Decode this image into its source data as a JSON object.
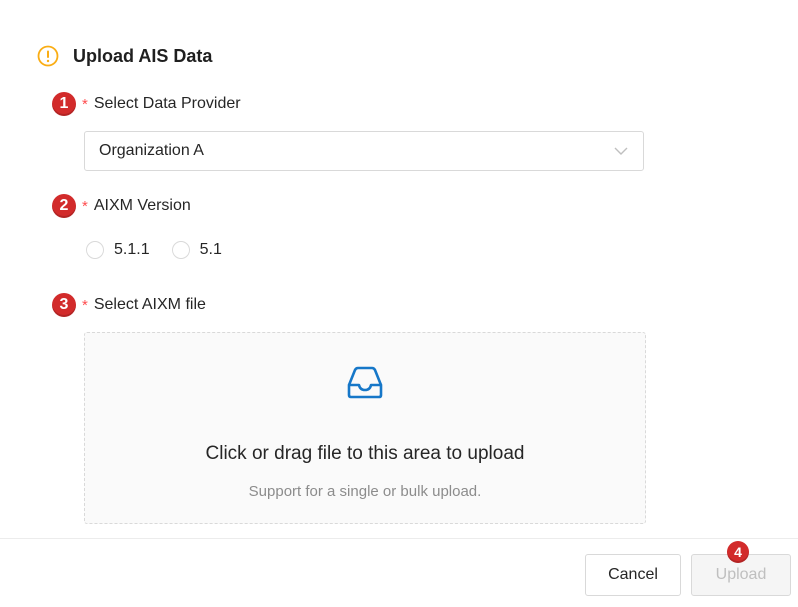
{
  "dialog": {
    "title": "Upload AIS Data",
    "icon": "exclamation-circle-icon",
    "accent_color": "#faad14"
  },
  "fields": [
    {
      "step": "1",
      "required": "*",
      "label": "Select Data Provider"
    },
    {
      "step": "2",
      "required": "*",
      "label": "AIXM Version"
    },
    {
      "step": "3",
      "required": "*",
      "label": "Select AIXM file"
    }
  ],
  "provider_select": {
    "value": "Organization A",
    "icon": "chevron-down-icon"
  },
  "aixm_versions": [
    {
      "label": "5.1.1",
      "selected": false
    },
    {
      "label": "5.1",
      "selected": false
    }
  ],
  "dropzone": {
    "icon": "inbox-icon",
    "text": "Click or drag file to this area to upload",
    "hint": "Support for a single or bulk upload.",
    "icon_color": "#1677c8"
  },
  "footer": {
    "cancel_label": "Cancel",
    "upload_label": "Upload",
    "upload_step": "4"
  },
  "colors": {
    "step_badge": "#d22b2b",
    "required_star": "#ff4d4f"
  }
}
